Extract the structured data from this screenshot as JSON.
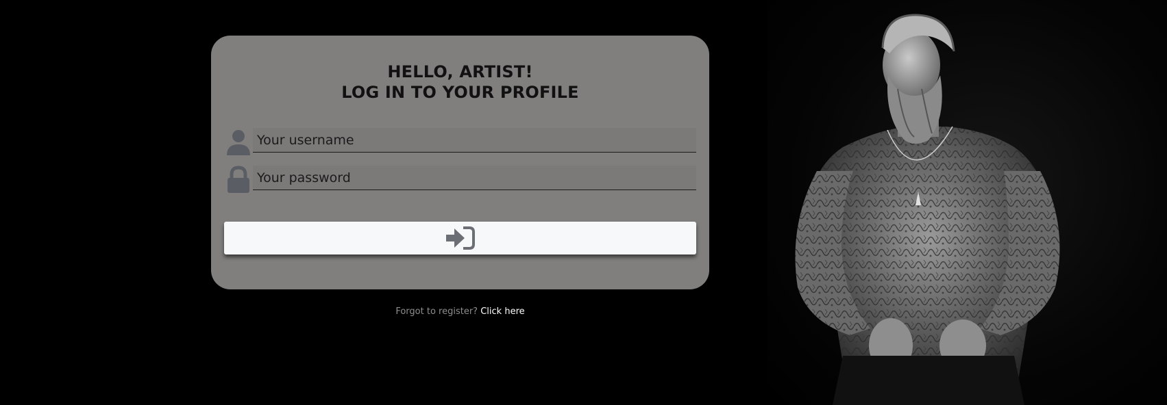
{
  "login": {
    "heading_line1": "HELLO, ARTIST!",
    "heading_line2": "LOG IN TO YOUR PROFILE",
    "username_placeholder": "Your username",
    "password_placeholder": "Your password",
    "submit_icon": "sign-in-icon",
    "username_icon": "user-icon",
    "password_icon": "lock-icon"
  },
  "footer": {
    "forgot_text": "Forgot to register?",
    "link_text": "Click here"
  },
  "colors": {
    "page_background": "#000000",
    "card_background": "#807f7d",
    "button_background": "#f7f8fa",
    "icon_color": "#5a5d63",
    "link_color": "#ffffff"
  },
  "photo": {
    "description_icon": "tattooed-man-portrait"
  }
}
